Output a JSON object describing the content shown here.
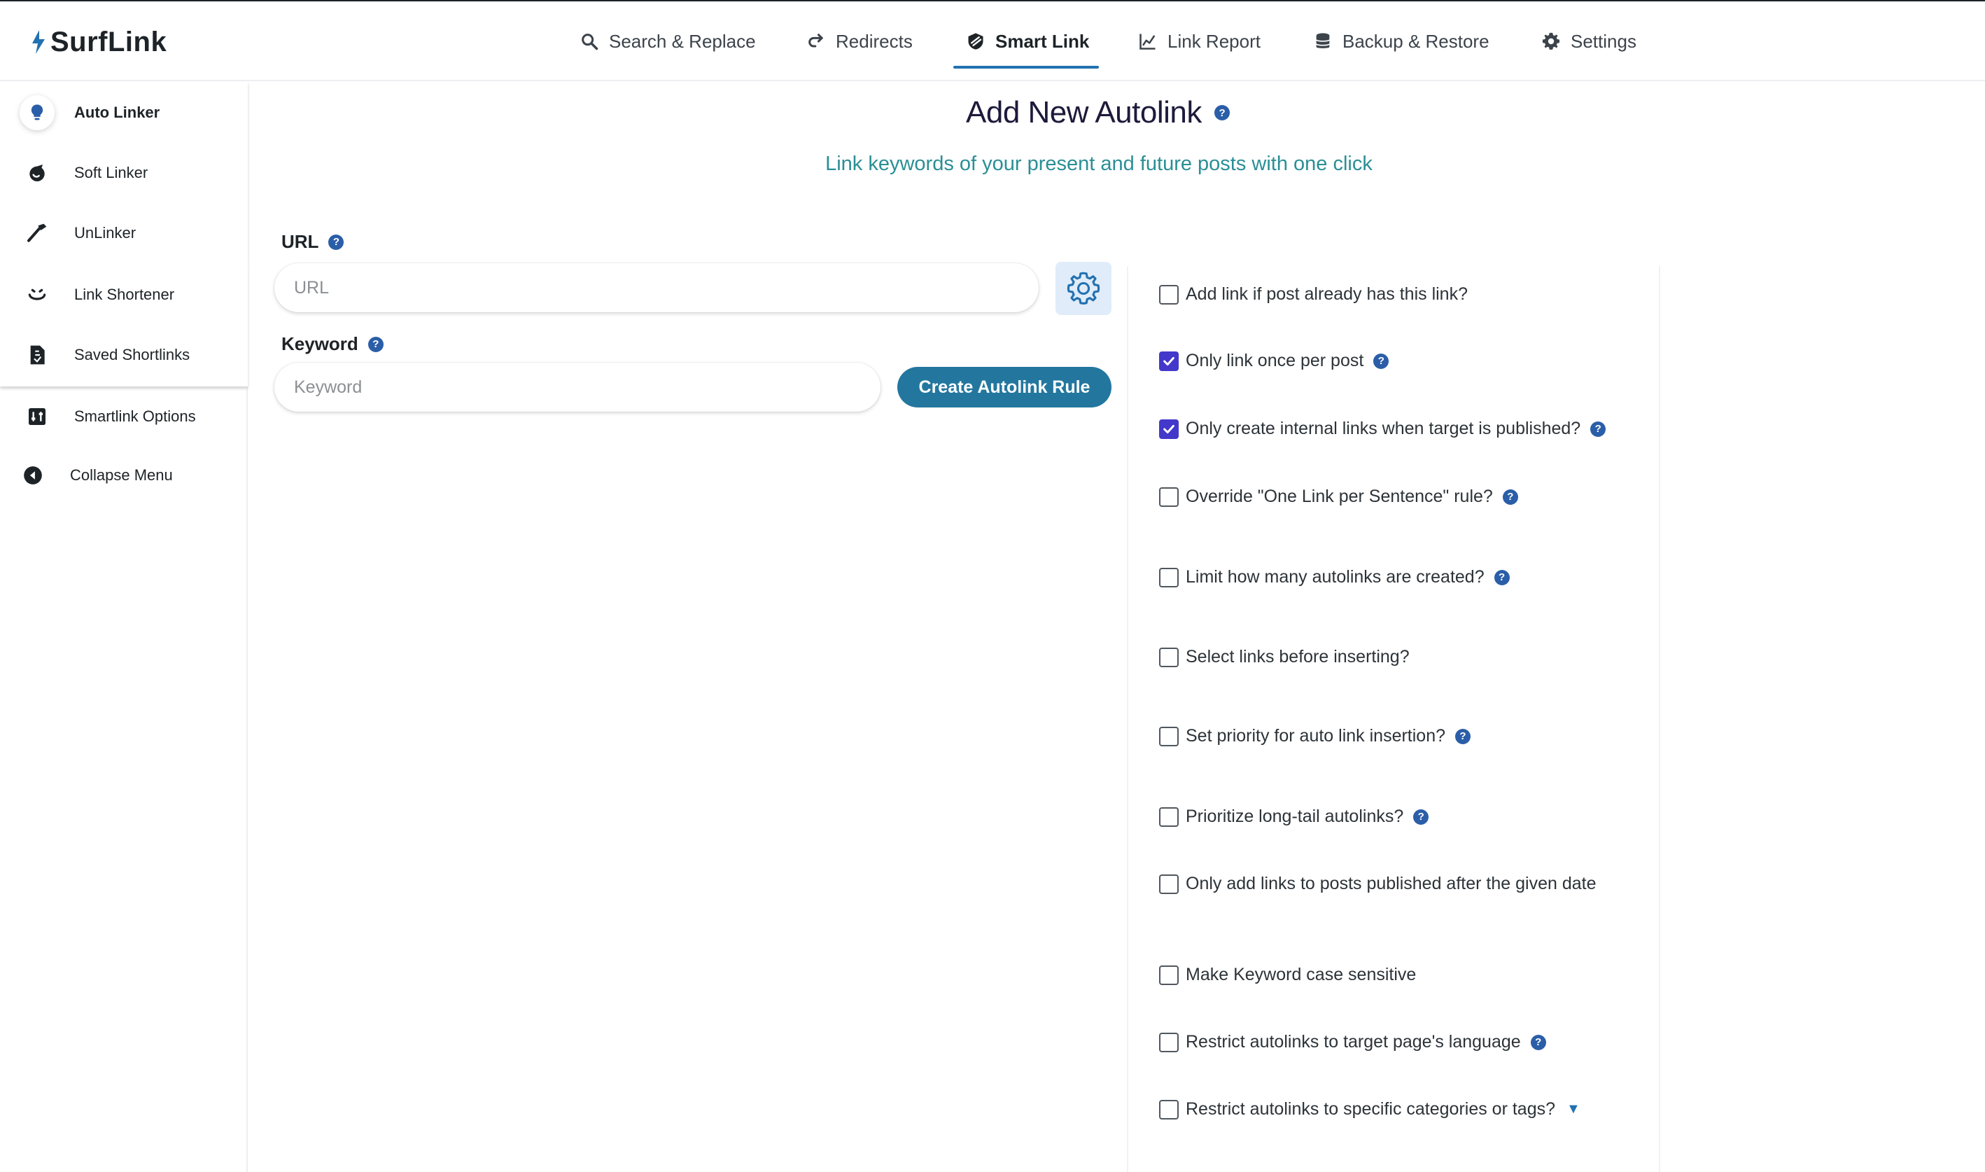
{
  "brand": {
    "name": "SurfLink"
  },
  "nav": {
    "items": [
      {
        "label": "Search & Replace",
        "icon": "search-icon"
      },
      {
        "label": "Redirects",
        "icon": "redirect-icon"
      },
      {
        "label": "Smart Link",
        "icon": "smart-link-icon",
        "active": true
      },
      {
        "label": "Link Report",
        "icon": "chart-icon"
      },
      {
        "label": "Backup & Restore",
        "icon": "database-icon"
      },
      {
        "label": "Settings",
        "icon": "gear-icon"
      }
    ]
  },
  "sidebar": {
    "items": [
      {
        "label": "Auto Linker",
        "icon": "lightbulb-icon",
        "active": true
      },
      {
        "label": "Soft Linker",
        "icon": "soft-link-icon"
      },
      {
        "label": "UnLinker",
        "icon": "hammer-icon"
      },
      {
        "label": "Link Shortener",
        "icon": "smile-icon"
      },
      {
        "label": "Saved Shortlinks",
        "icon": "document-icon"
      },
      {
        "label": "Smartlink Options",
        "icon": "options-icon"
      }
    ],
    "collapse_label": "Collapse Menu"
  },
  "main": {
    "title": "Add New Autolink",
    "subtitle": "Link keywords of your present and future posts with one click",
    "url_label": "URL",
    "url_placeholder": "URL",
    "keyword_label": "Keyword",
    "keyword_placeholder": "Keyword",
    "create_button": "Create Autolink Rule"
  },
  "options": [
    {
      "label": "Add link if post already has this link?",
      "checked": false,
      "help": false
    },
    {
      "label": "Only link once per post",
      "checked": true,
      "help": true
    },
    {
      "label": "Only create internal links when target is published?",
      "checked": true,
      "help": true
    },
    {
      "label": "Override \"One Link per Sentence\" rule?",
      "checked": false,
      "help": true
    },
    {
      "label": "Limit how many autolinks are created?",
      "checked": false,
      "help": true
    },
    {
      "label": "Select links before inserting?",
      "checked": false,
      "help": false
    },
    {
      "label": "Set priority for auto link insertion?",
      "checked": false,
      "help": true
    },
    {
      "label": "Prioritize long-tail autolinks?",
      "checked": false,
      "help": true
    },
    {
      "label": "Only add links to posts published after the given date",
      "checked": false,
      "help": false
    },
    {
      "label": "Make Keyword case sensitive",
      "checked": false,
      "help": false
    },
    {
      "label": "Restrict autolinks to target page's language",
      "checked": false,
      "help": true
    },
    {
      "label": "Restrict autolinks to specific categories or tags?",
      "checked": false,
      "help": false,
      "dropdown": true
    }
  ],
  "help_glyph": "?",
  "dropdown_glyph": "▼",
  "colors": {
    "accent": "#2271b1",
    "button": "#23779f",
    "checkbox": "#4338ca",
    "subtitle": "#2a8f95",
    "help": "#2b5ea8"
  }
}
